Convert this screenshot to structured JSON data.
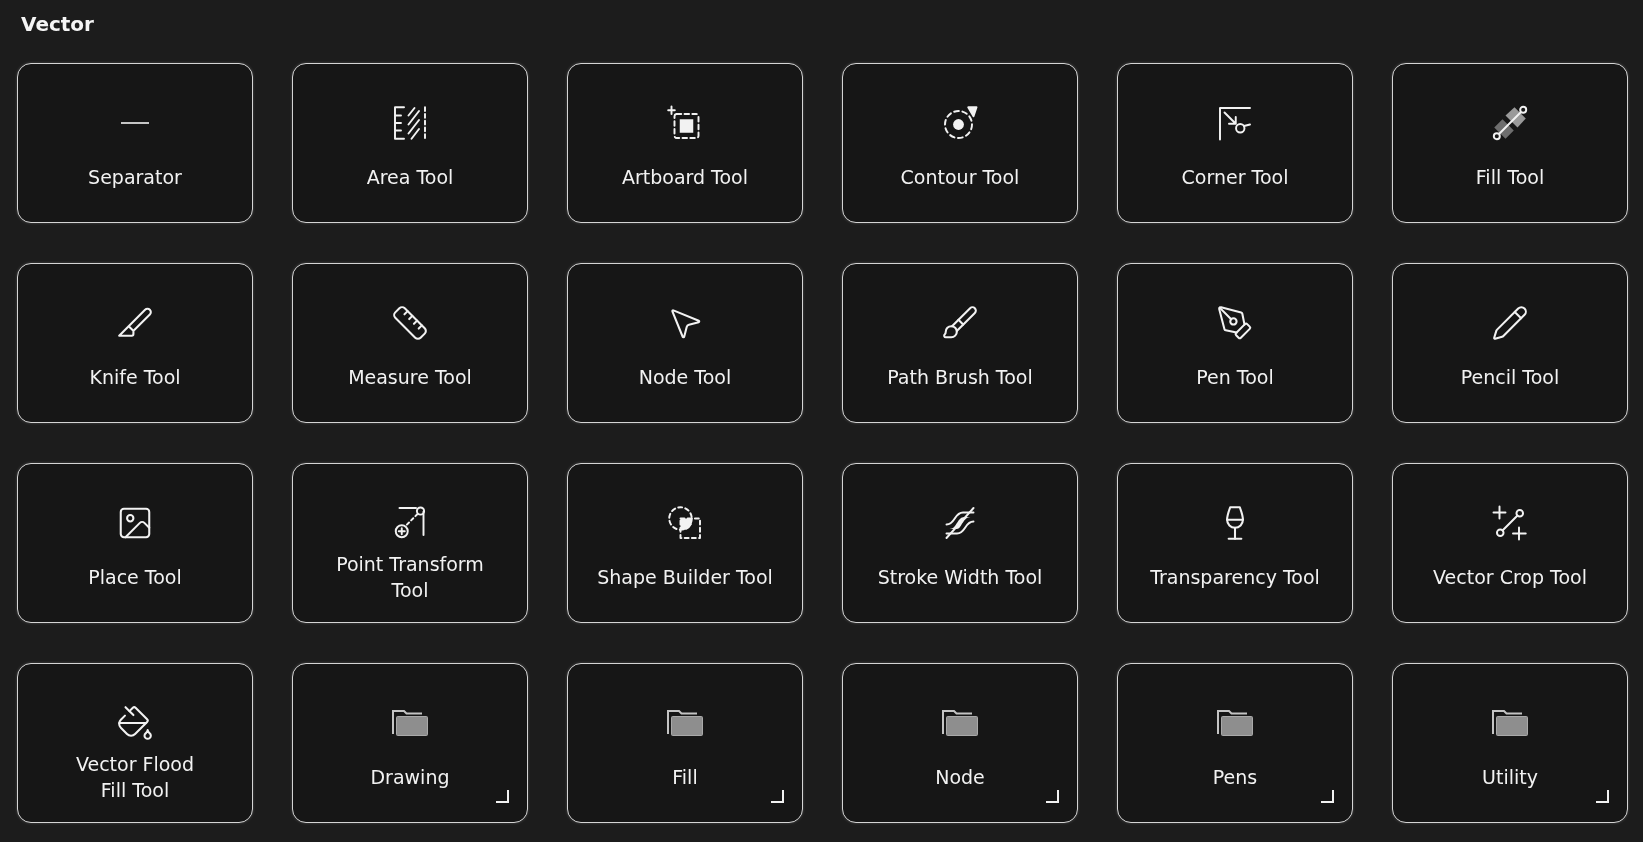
{
  "section": {
    "title": "Vector"
  },
  "tiles": [
    {
      "kind": "tool",
      "label": "Separator"
    },
    {
      "kind": "tool",
      "label": "Area Tool"
    },
    {
      "kind": "tool",
      "label": "Artboard Tool"
    },
    {
      "kind": "tool",
      "label": "Contour Tool"
    },
    {
      "kind": "tool",
      "label": "Corner Tool"
    },
    {
      "kind": "tool",
      "label": "Fill Tool"
    },
    {
      "kind": "tool",
      "label": "Knife Tool"
    },
    {
      "kind": "tool",
      "label": "Measure Tool"
    },
    {
      "kind": "tool",
      "label": "Node Tool"
    },
    {
      "kind": "tool",
      "label": "Path Brush Tool"
    },
    {
      "kind": "tool",
      "label": "Pen Tool"
    },
    {
      "kind": "tool",
      "label": "Pencil Tool"
    },
    {
      "kind": "tool",
      "label": "Place Tool"
    },
    {
      "kind": "tool",
      "label": "Point Transform\nTool"
    },
    {
      "kind": "tool",
      "label": "Shape Builder Tool"
    },
    {
      "kind": "tool",
      "label": "Stroke Width Tool"
    },
    {
      "kind": "tool",
      "label": "Transparency Tool"
    },
    {
      "kind": "tool",
      "label": "Vector Crop Tool"
    },
    {
      "kind": "tool",
      "label": "Vector Flood\nFill Tool"
    },
    {
      "kind": "group",
      "label": "Drawing"
    },
    {
      "kind": "group",
      "label": "Fill"
    },
    {
      "kind": "group",
      "label": "Node"
    },
    {
      "kind": "group",
      "label": "Pens"
    },
    {
      "kind": "group",
      "label": "Utility"
    }
  ]
}
